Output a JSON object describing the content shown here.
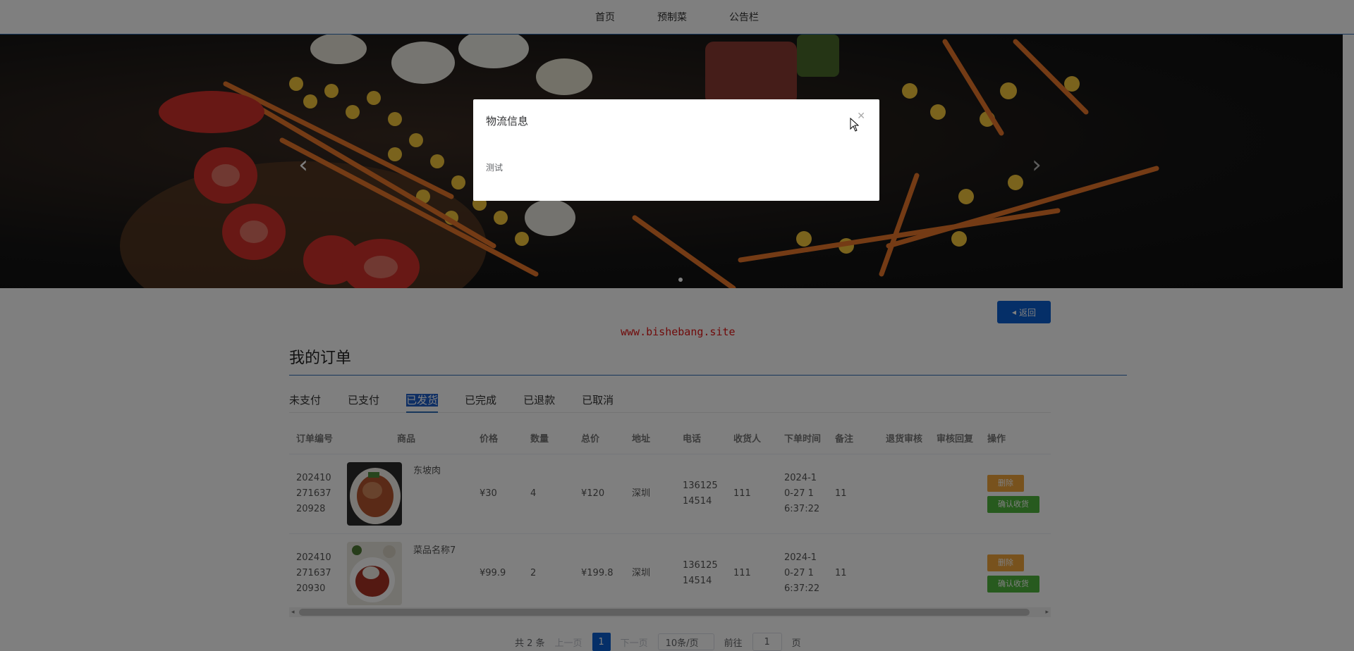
{
  "nav": {
    "items": [
      {
        "label": "首页"
      },
      {
        "label": "预制菜"
      },
      {
        "label": "公告栏"
      }
    ]
  },
  "banner": {
    "prev_icon": "chevron-left-icon",
    "next_icon": "chevron-right-icon"
  },
  "back_button": {
    "label": "返回",
    "icon": "caret-left-icon"
  },
  "watermark": "www.bishebang.site",
  "orders": {
    "title": "我的订单",
    "tabs": [
      {
        "label": "未支付"
      },
      {
        "label": "已支付"
      },
      {
        "label": "已发货",
        "active": true
      },
      {
        "label": "已完成"
      },
      {
        "label": "已退款"
      },
      {
        "label": "已取消"
      }
    ],
    "columns": [
      "订单编号",
      "商品",
      "价格",
      "数量",
      "总价",
      "地址",
      "电话",
      "收货人",
      "下单时间",
      "备注",
      "退货审核",
      "审核回复",
      "操作"
    ],
    "rows": [
      {
        "order_no": "20241027163720928",
        "product": "东坡肉",
        "price": "¥30",
        "qty": "4",
        "total": "¥120",
        "address": "深圳",
        "phone": "13612514514",
        "receiver": "111",
        "time": "2024-10-27 16:37:22",
        "note": "11",
        "return_review": "",
        "review_reply": "",
        "btn_delete": "删除",
        "btn_confirm": "确认收货"
      },
      {
        "order_no": "20241027163720930",
        "product": "菜品名称7",
        "price": "¥99.9",
        "qty": "2",
        "total": "¥199.8",
        "address": "深圳",
        "phone": "13612514514",
        "receiver": "111",
        "time": "2024-10-27 16:37:22",
        "note": "11",
        "return_review": "",
        "review_reply": "",
        "btn_delete": "删除",
        "btn_confirm": "确认收货"
      }
    ]
  },
  "pagination": {
    "total_text": "共 2 条",
    "prev_label": "上一页",
    "current_page": "1",
    "next_label": "下一页",
    "page_size": "10条/页",
    "goto_label": "前往",
    "goto_value": "1",
    "page_unit": "页"
  },
  "dialog": {
    "title": "物流信息",
    "body": "测试",
    "close_icon": "close-icon"
  }
}
